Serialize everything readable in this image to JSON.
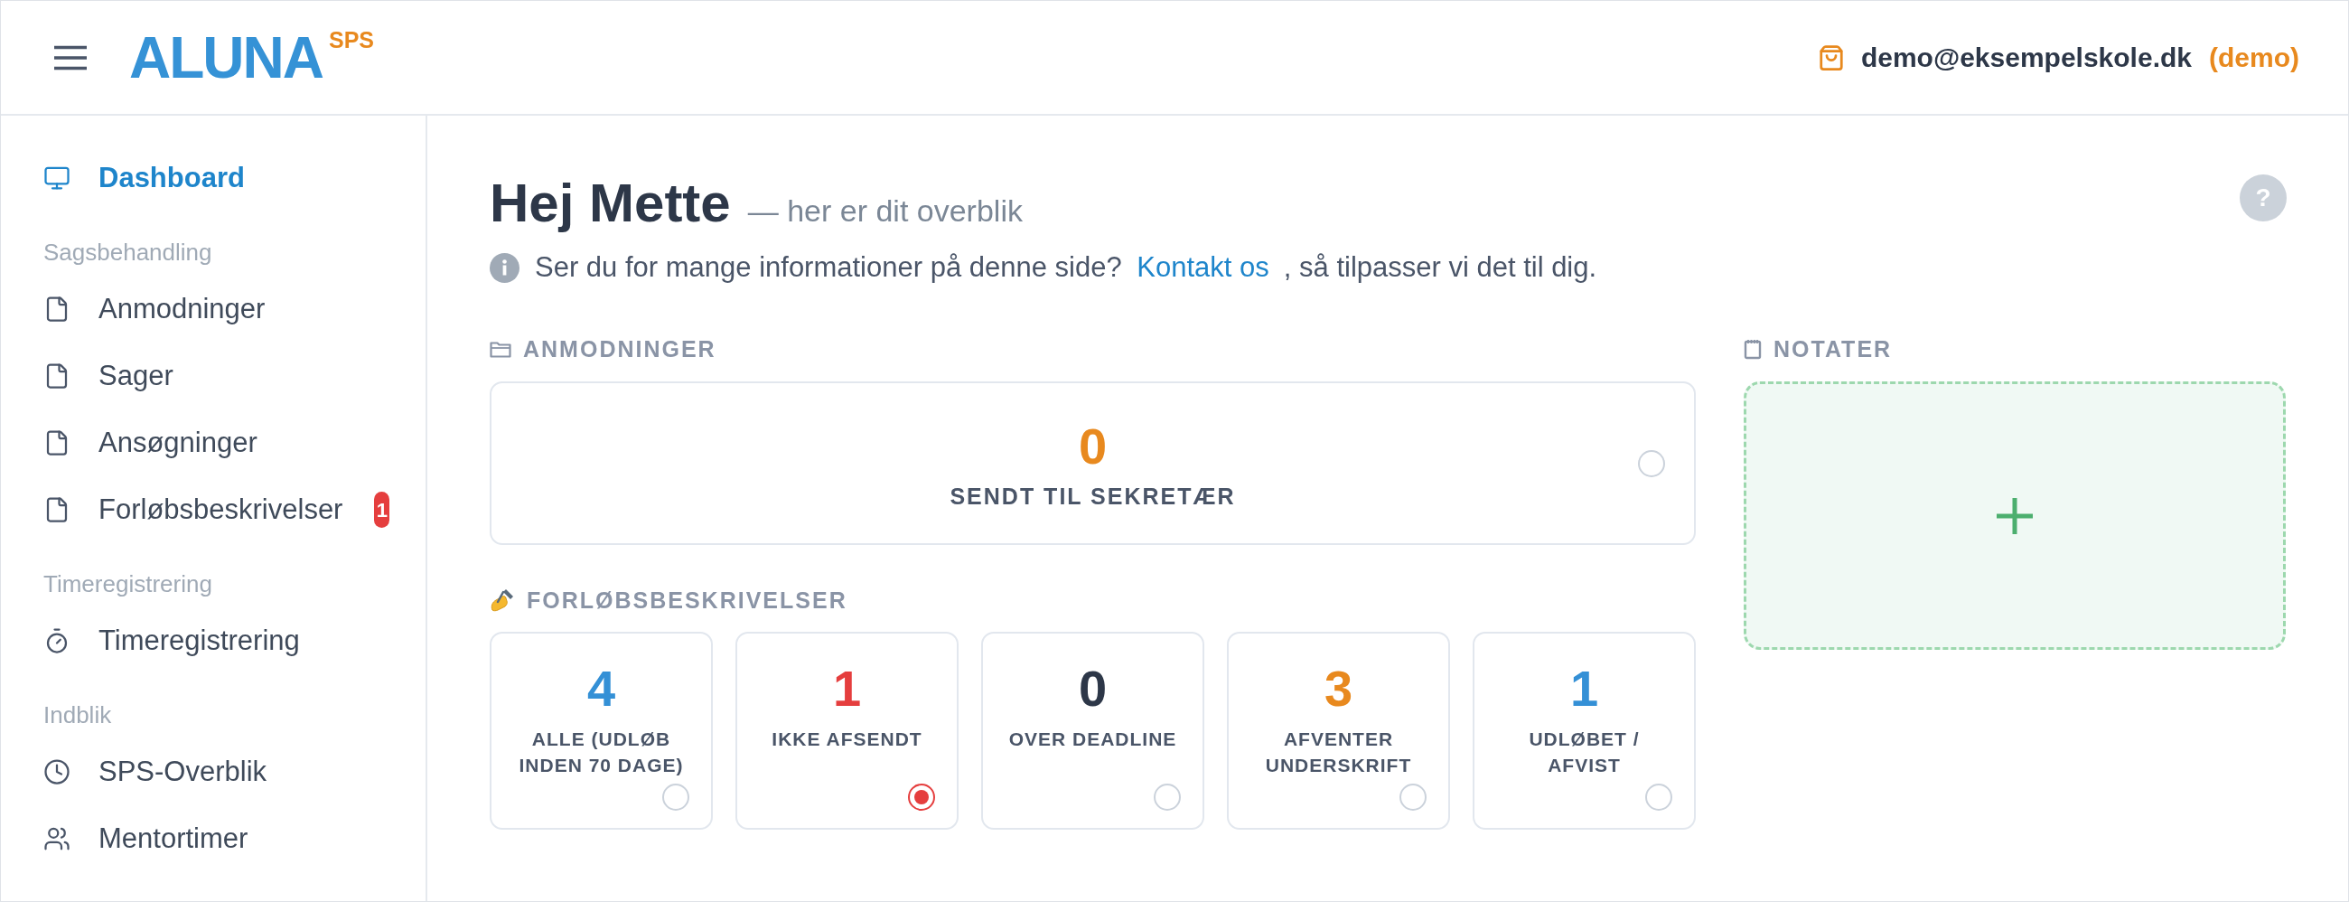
{
  "header": {
    "logo": "ALUNA",
    "logo_suffix": "SPS",
    "user_email": "demo@eksempelskole.dk",
    "user_role": "(demo)"
  },
  "sidebar": {
    "groups": [
      {
        "items": [
          {
            "label": "Dashboard",
            "selected": true
          }
        ]
      },
      {
        "title": "Sagsbehandling",
        "items": [
          {
            "label": "Anmodninger",
            "selected": false
          },
          {
            "label": "Sager",
            "selected": false
          },
          {
            "label": "Ansøgninger",
            "selected": false
          },
          {
            "label": "Forløbsbeskrivelser",
            "selected": false,
            "badge": "1"
          }
        ]
      },
      {
        "title": "Timeregistrering",
        "items": [
          {
            "label": "Timeregistrering",
            "selected": false
          }
        ]
      },
      {
        "title": "Indblik",
        "items": [
          {
            "label": "SPS-Overblik",
            "selected": false
          },
          {
            "label": "Mentortimer",
            "selected": false
          }
        ]
      }
    ]
  },
  "page": {
    "title": "Hej Mette",
    "subtitle": "— her er dit overblik",
    "help_button": "?",
    "info": {
      "text_before": "Ser du for mange informationer på denne side?",
      "link": "Kontakt os",
      "text_after": ", så tilpasser vi det til dig."
    }
  },
  "anmodninger": {
    "heading": "ANMODNINGER",
    "cards": [
      {
        "count": "0",
        "label": "SENDT TIL SEKRETÆR",
        "color": "#e8891e",
        "selected": false
      }
    ]
  },
  "forlobsbeskrivelser": {
    "heading": "FORLØBSBESKRIVELSER",
    "cards": [
      {
        "count": "4",
        "label": "ALLE (UDLØB INDEN 70 DAGE)",
        "color": "#3490d6",
        "selected": false
      },
      {
        "count": "1",
        "label": "IKKE AFSENDT",
        "color": "#e53e3e",
        "selected": true
      },
      {
        "count": "0",
        "label": "OVER DEADLINE",
        "color": "#2d3748",
        "selected": false
      },
      {
        "count": "3",
        "label": "AFVENTER UNDERSKRIFT",
        "color": "#e8891e",
        "selected": false
      },
      {
        "count": "1",
        "label": "UDLØBET / AFVIST",
        "color": "#3490d6",
        "selected": false
      }
    ]
  },
  "notater": {
    "heading": "NOTATER"
  }
}
